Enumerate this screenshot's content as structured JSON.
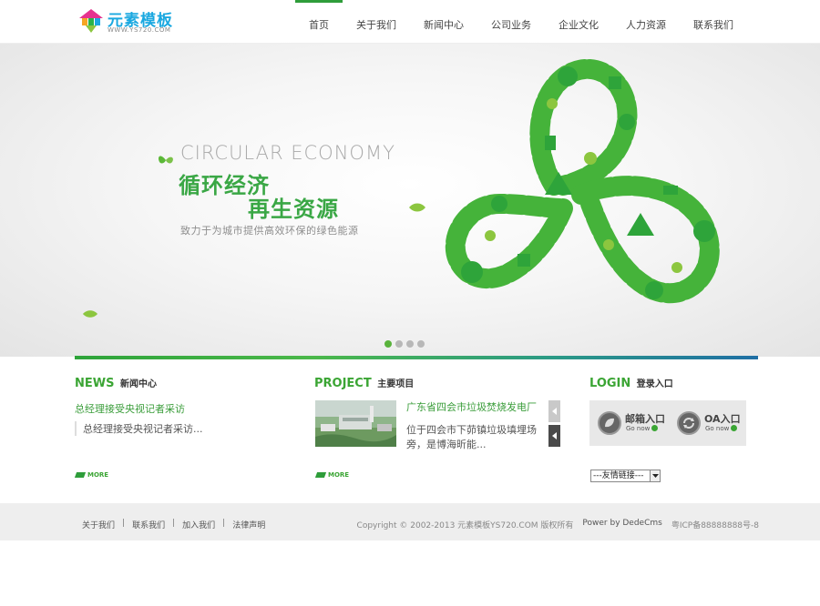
{
  "header": {
    "logo_title": "元素模板",
    "logo_sub": "WWW.YS720.COM",
    "nav": [
      {
        "label": "首页",
        "active": true
      },
      {
        "label": "关于我们",
        "active": false
      },
      {
        "label": "新闻中心",
        "active": false
      },
      {
        "label": "公司业务",
        "active": false
      },
      {
        "label": "企业文化",
        "active": false
      },
      {
        "label": "人力资源",
        "active": false
      },
      {
        "label": "联系我们",
        "active": false
      }
    ]
  },
  "banner": {
    "en_title": "CIRCULAR ECONOMY",
    "cn_line1": "循环经济",
    "cn_line2": "再生资源",
    "slogan": "致力于为城市提供高效环保的绿色能源",
    "slides_total": 4,
    "active_slide": 1
  },
  "news": {
    "title_en": "NEWS",
    "title_cn": "新闻中心",
    "link": "总经理接受央视记者采访",
    "desc": "总经理接受央视记者采访...",
    "more": "MORE"
  },
  "project": {
    "title_en": "PROJECT",
    "title_cn": "主要项目",
    "name": "广东省四会市垃圾焚烧发电厂",
    "desc": "位于四会市下茆镇垃圾填埋场旁，是博海昕能...",
    "more": "MORE"
  },
  "login": {
    "title_en": "LOGIN",
    "title_cn": "登录入口",
    "mail_label": "邮箱入口",
    "oa_label": "OA入口",
    "go_text": "Go now",
    "friend_links": "---友情链接---"
  },
  "footer": {
    "links": [
      "关于我们",
      "联系我们",
      "加入我们",
      "法律声明"
    ],
    "copyright": "Copyright © 2002-2013 元素模板YS720.COM 版权所有",
    "powered": "Power by DedeCms",
    "icp": "粤ICP备88888888号-8"
  },
  "colors": {
    "brand_green": "#3ba534",
    "logo_blue": "#1aa8e0"
  }
}
